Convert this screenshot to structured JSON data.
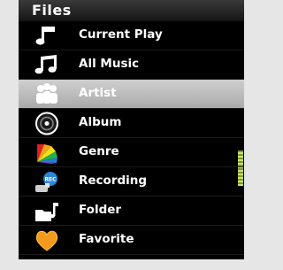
{
  "header": {
    "title": "Files"
  },
  "menu": {
    "items": [
      {
        "label": "Current Play",
        "icon": "music-note-icon"
      },
      {
        "label": "All Music",
        "icon": "music-notes-icon"
      },
      {
        "label": "Artist",
        "icon": "artist-icon"
      },
      {
        "label": "Album",
        "icon": "disc-icon"
      },
      {
        "label": "Genre",
        "icon": "genre-color-icon"
      },
      {
        "label": "Recording",
        "icon": "recording-icon"
      },
      {
        "label": "Folder",
        "icon": "folder-music-icon"
      },
      {
        "label": "Favorite",
        "icon": "heart-icon"
      }
    ],
    "selected_index": 2
  },
  "colors": {
    "selection": "#bcbcbc",
    "scroll_indicator": "#a8c63a",
    "heart": "#f39a1e"
  }
}
